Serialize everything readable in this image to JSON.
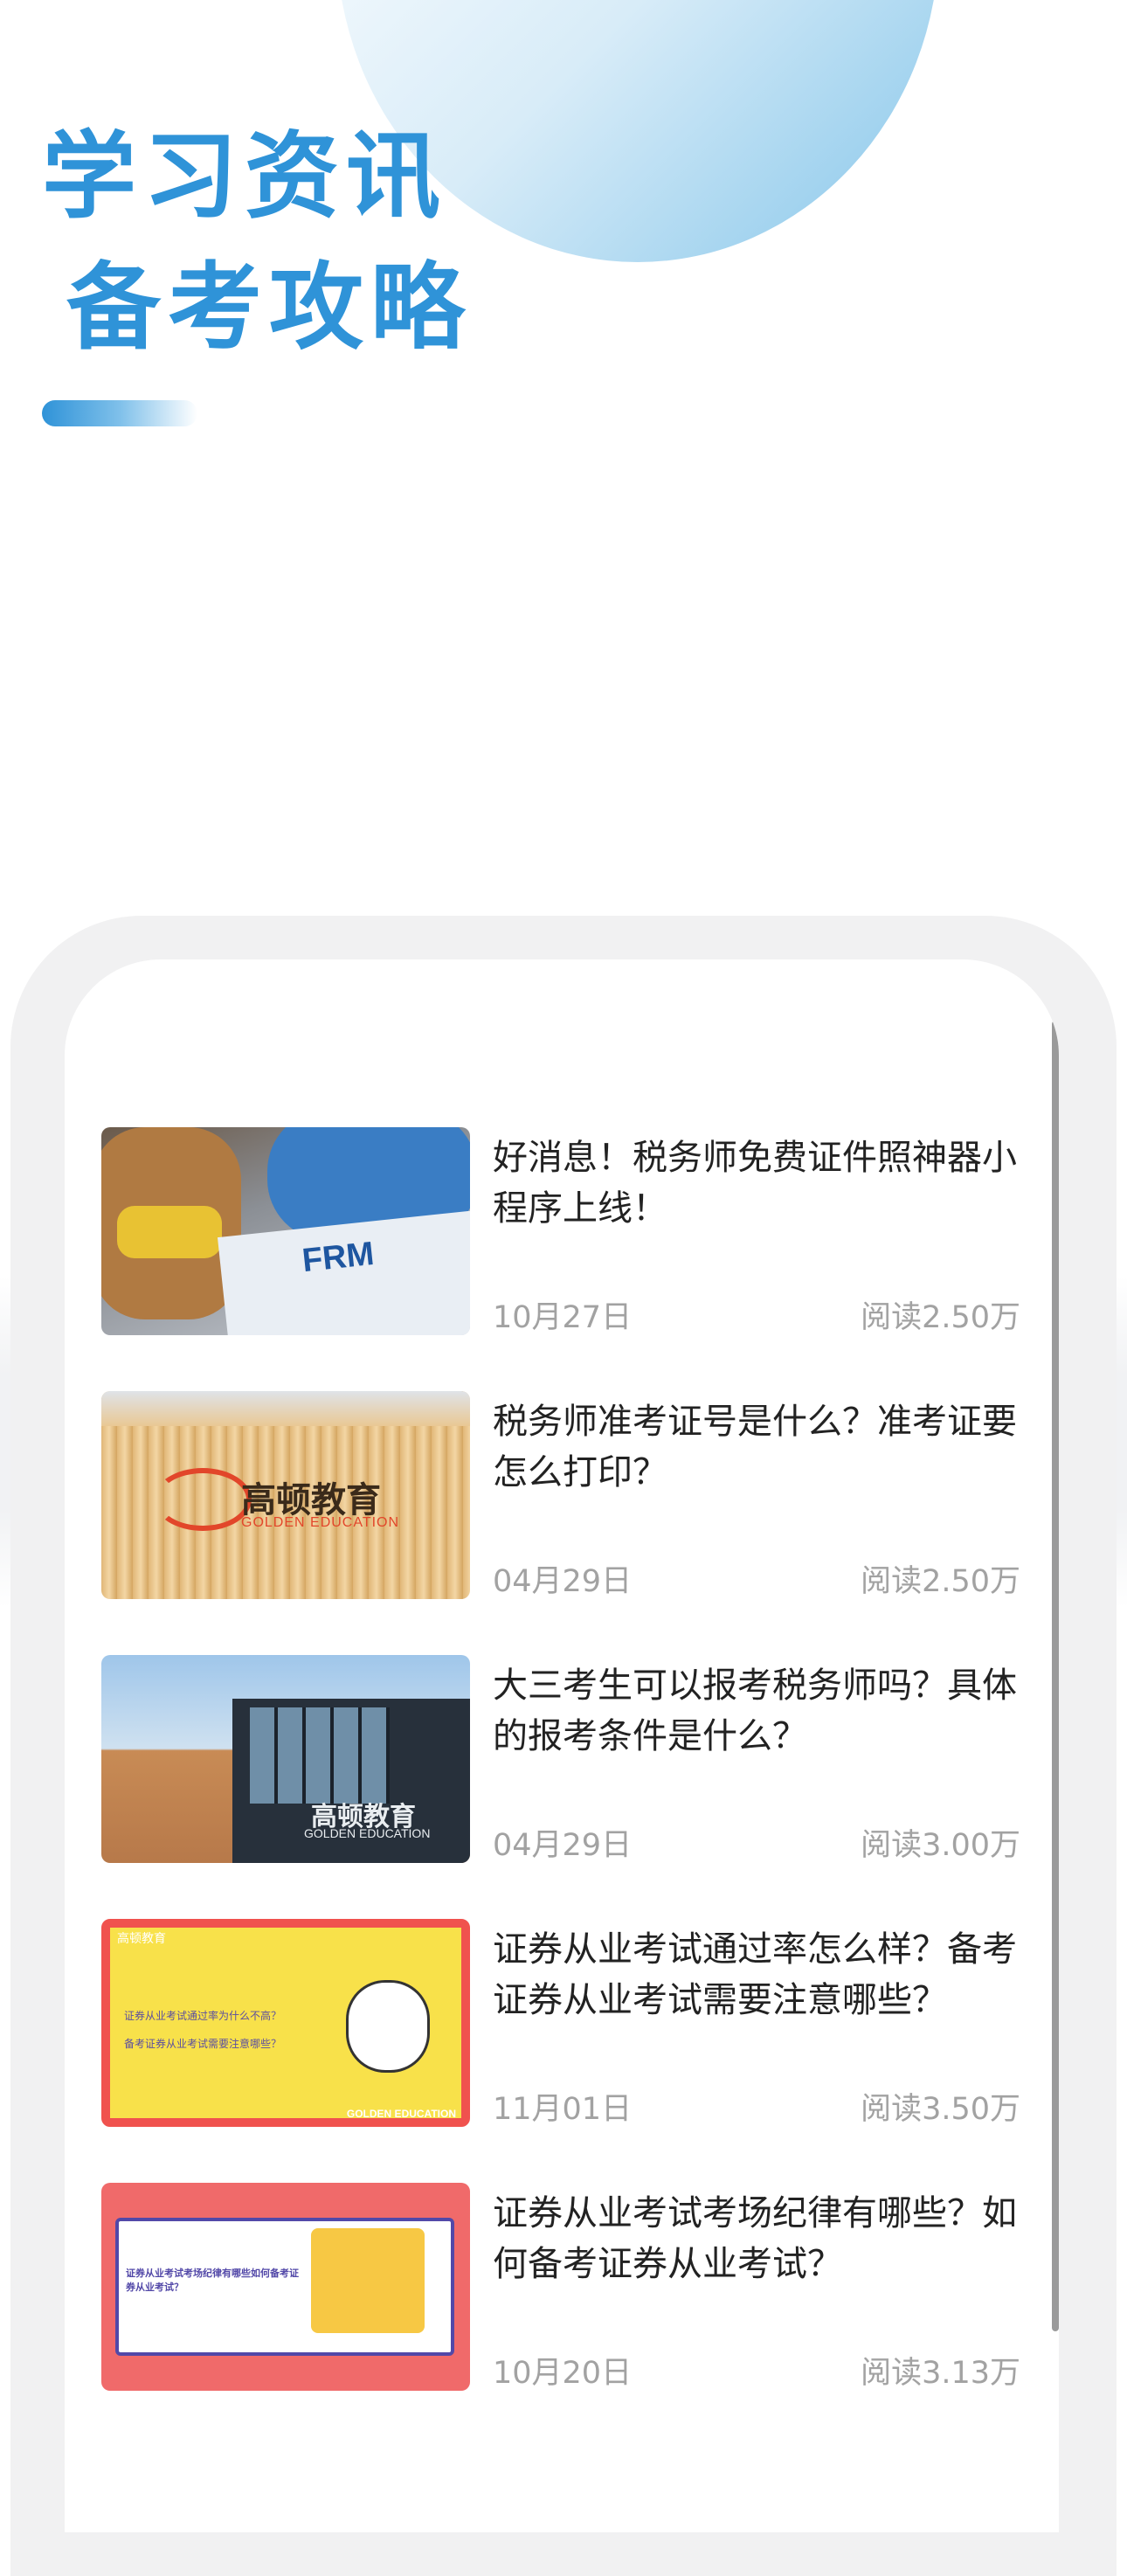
{
  "header": {
    "title_line1": "学习资讯",
    "title_line2": "备考攻略"
  },
  "colors": {
    "accent": "#2f93d8",
    "title_text": "#222222",
    "meta_text": "#a2a2a2",
    "frame": "#f1f1f2"
  },
  "news": [
    {
      "title": "好消息！税务师免费证件照神器小程序上线！",
      "date": "10月27日",
      "reads": "阅读2.50万",
      "thumb": {
        "text": "FRM"
      }
    },
    {
      "title": "税务师准考证号是什么？准考证要怎么打印？",
      "date": "04月29日",
      "reads": "阅读2.50万",
      "thumb": {
        "brand": "高顿教育",
        "sub": "GOLDEN EDUCATION"
      }
    },
    {
      "title": "大三考生可以报考税务师吗？具体的报考条件是什么？",
      "date": "04月29日",
      "reads": "阅读3.00万",
      "thumb": {
        "brand": "高顿教育",
        "sub": "GOLDEN EDUCATION"
      }
    },
    {
      "title": "证券从业考试通过率怎么样？备考证券从业考试需要注意哪些？",
      "date": "11月01日",
      "reads": "阅读3.50万",
      "thumb": {
        "header": "高顿教育",
        "q1": "证券从业考试通过率为什么不高？",
        "q2": "备考证券从业考试需要注意哪些？",
        "footer": "GOLDEN EDUCATION"
      }
    },
    {
      "title": "证券从业考试考场纪律有哪些？如何备考证券从业考试？",
      "date": "10月20日",
      "reads": "阅读3.13万",
      "thumb": {
        "caption": "证券从业考试考场纪律有哪些如何备考证券从业考试？"
      }
    }
  ]
}
